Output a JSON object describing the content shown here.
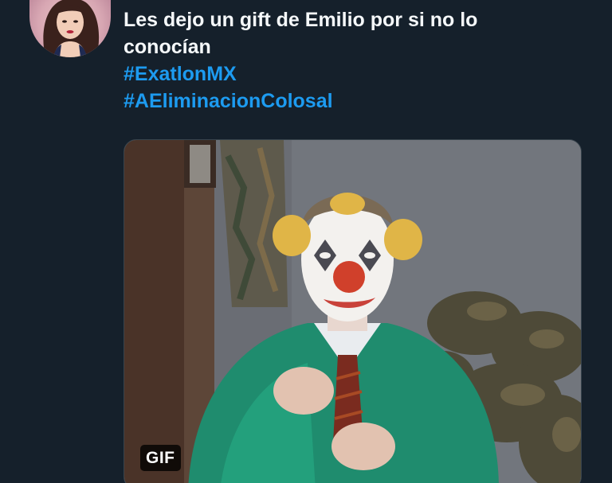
{
  "tweet": {
    "text_line1": "Les dejo un gift de Emilio por si no lo",
    "text_line2": "conocían",
    "hashtags": [
      "#ExatlonMX",
      "#AEliminacionColosal"
    ],
    "media": {
      "type": "gif",
      "badge_label": "GIF",
      "content": "clown-faced man in green cardigan"
    }
  },
  "colors": {
    "background": "#15202b",
    "text": "#f5f8fa",
    "hashtag": "#1d9bf0"
  }
}
